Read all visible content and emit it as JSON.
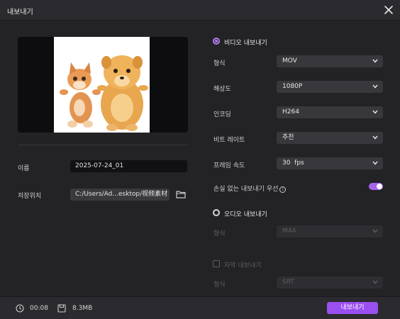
{
  "window": {
    "title": "내보내기"
  },
  "left": {
    "name_label": "이름",
    "name_value": "2025-07-24_01",
    "location_label": "저장위치",
    "location_value": "C:/Users/Ad...esktop/视频素材"
  },
  "video": {
    "section_label": "비디오 내보내기",
    "rows": [
      {
        "label": "형식",
        "value": "MOV"
      },
      {
        "label": "해상도",
        "value": "1080P"
      },
      {
        "label": "인코딩",
        "value": "H264"
      },
      {
        "label": "비트 레이트",
        "value": "추천"
      },
      {
        "label": "프레임 속도",
        "value": "30  fps"
      }
    ],
    "lossless_label": "손실 없는 내보내기 우선",
    "lossless_info_icon": "i",
    "lossless_on": true
  },
  "audio": {
    "section_label": "오디오 내보내기",
    "format_label": "형식",
    "format_value": "M4A"
  },
  "subtitle": {
    "checkbox_label": "자막 내보내기",
    "format_label": "형식",
    "format_value": "SRT"
  },
  "footer": {
    "duration": "00:08",
    "size": "8.3MB",
    "export_label": "내보내기"
  },
  "colors": {
    "accent": "#9a4ff0",
    "toggle": "#a565ec",
    "background": "#232326"
  }
}
